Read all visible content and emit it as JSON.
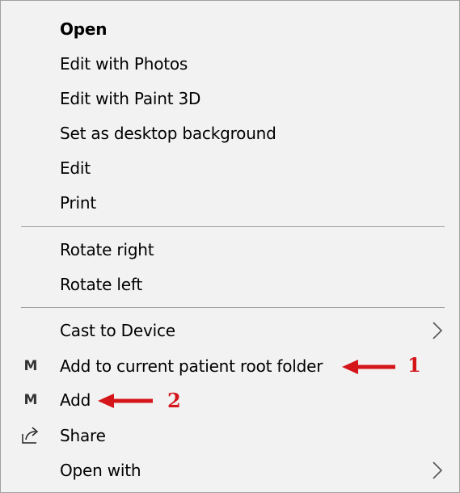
{
  "menu": {
    "items": [
      {
        "label": "Open"
      },
      {
        "label": "Edit with Photos"
      },
      {
        "label": "Edit with Paint 3D"
      },
      {
        "label": "Set as desktop background"
      },
      {
        "label": "Edit"
      },
      {
        "label": "Print"
      },
      {
        "label": "Rotate right"
      },
      {
        "label": "Rotate left"
      },
      {
        "label": "Cast to Device"
      },
      {
        "label": "Add to current patient root folder",
        "icon_text": "M"
      },
      {
        "label": "Add",
        "icon_text": "M"
      },
      {
        "label": "Share"
      },
      {
        "label": "Open with"
      }
    ]
  },
  "annotations": [
    {
      "number": "1",
      "color": "#d4161b"
    },
    {
      "number": "2",
      "color": "#d4161b"
    }
  ],
  "icons": {
    "submenu": "chevron-right-icon",
    "share": "share-icon",
    "app": "m-app-icon"
  }
}
